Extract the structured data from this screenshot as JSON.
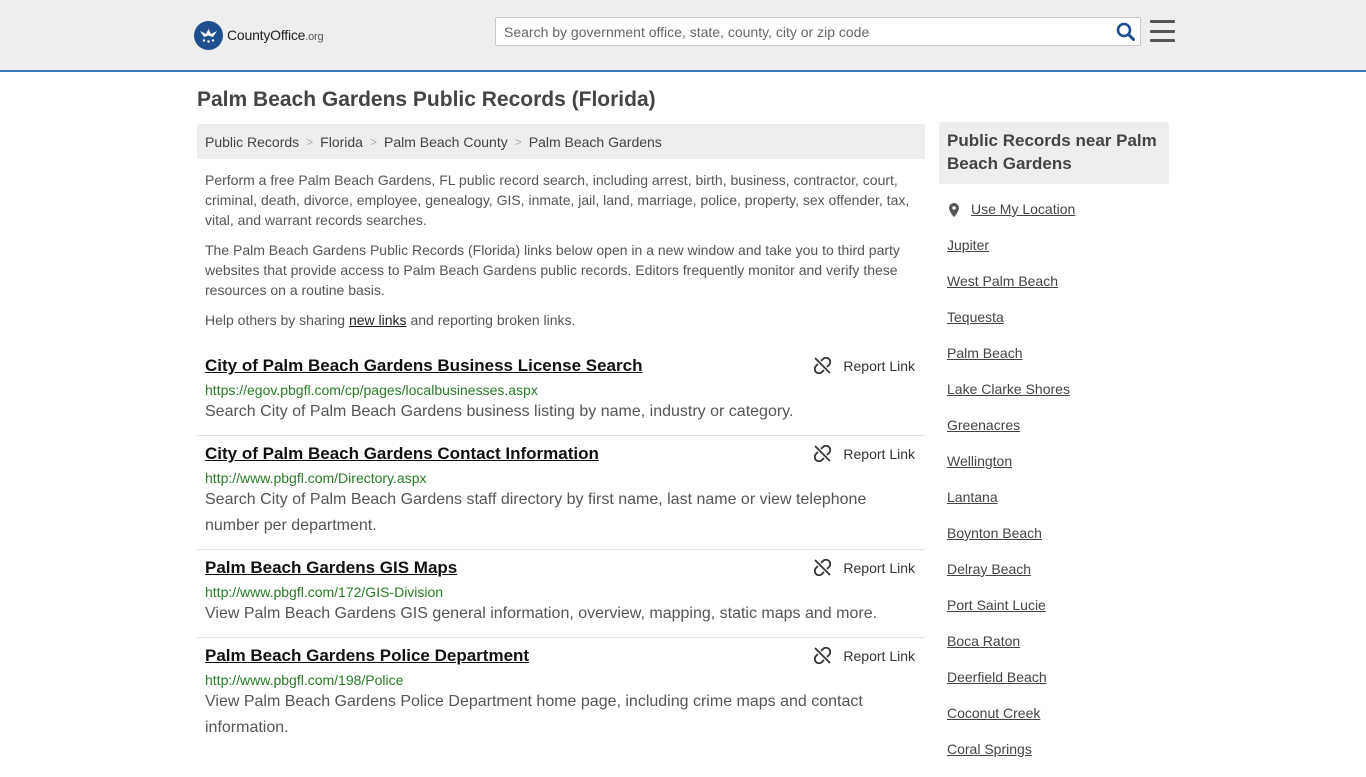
{
  "brand": {
    "name_main": "CountyOffice",
    "name_suffix": ".org",
    "accent_color": "#3a73b8",
    "logo_color": "#1f4f8f"
  },
  "search": {
    "placeholder": "Search by government office, state, county, city or zip code",
    "value": "",
    "icon": "search-icon"
  },
  "page_title": "Palm Beach Gardens Public Records (Florida)",
  "breadcrumb": [
    "Public Records",
    "Florida",
    "Palm Beach County",
    "Palm Beach Gardens"
  ],
  "intro": {
    "p1": "Perform a free Palm Beach Gardens, FL public record search, including arrest, birth, business, contractor, court, criminal, death, divorce, employee, genealogy, GIS, inmate, jail, land, marriage, police, property, sex offender, tax, vital, and warrant records searches.",
    "p2": "The Palm Beach Gardens Public Records (Florida) links below open in a new window and take you to third party websites that provide access to Palm Beach Gardens public records. Editors frequently monitor and verify these resources on a routine basis.",
    "p3_before": "Help others by sharing ",
    "p3_link": "new links",
    "p3_after": " and reporting broken links."
  },
  "report_label": "Report Link",
  "results": [
    {
      "title": "City of Palm Beach Gardens Business License Search",
      "url": "https://egov.pbgfl.com/cp/pages/localbusinesses.aspx",
      "desc": "Search City of Palm Beach Gardens business listing by name, industry or category."
    },
    {
      "title": "City of Palm Beach Gardens Contact Information",
      "url": "http://www.pbgfl.com/Directory.aspx",
      "desc": "Search City of Palm Beach Gardens staff directory by first name, last name or view telephone number per department."
    },
    {
      "title": "Palm Beach Gardens GIS Maps",
      "url": "http://www.pbgfl.com/172/GIS-Division",
      "desc": "View Palm Beach Gardens GIS general information, overview, mapping, static maps and more."
    },
    {
      "title": "Palm Beach Gardens Police Department",
      "url": "http://www.pbgfl.com/198/Police",
      "desc": "View Palm Beach Gardens Police Department home page, including crime maps and contact information."
    }
  ],
  "sidebar": {
    "heading": "Public Records near Palm Beach Gardens",
    "use_location": "Use My Location",
    "cities": [
      "Jupiter",
      "West Palm Beach",
      "Tequesta",
      "Palm Beach",
      "Lake Clarke Shores",
      "Greenacres",
      "Wellington",
      "Lantana",
      "Boynton Beach",
      "Delray Beach",
      "Port Saint Lucie",
      "Boca Raton",
      "Deerfield Beach",
      "Coconut Creek",
      "Coral Springs"
    ]
  }
}
